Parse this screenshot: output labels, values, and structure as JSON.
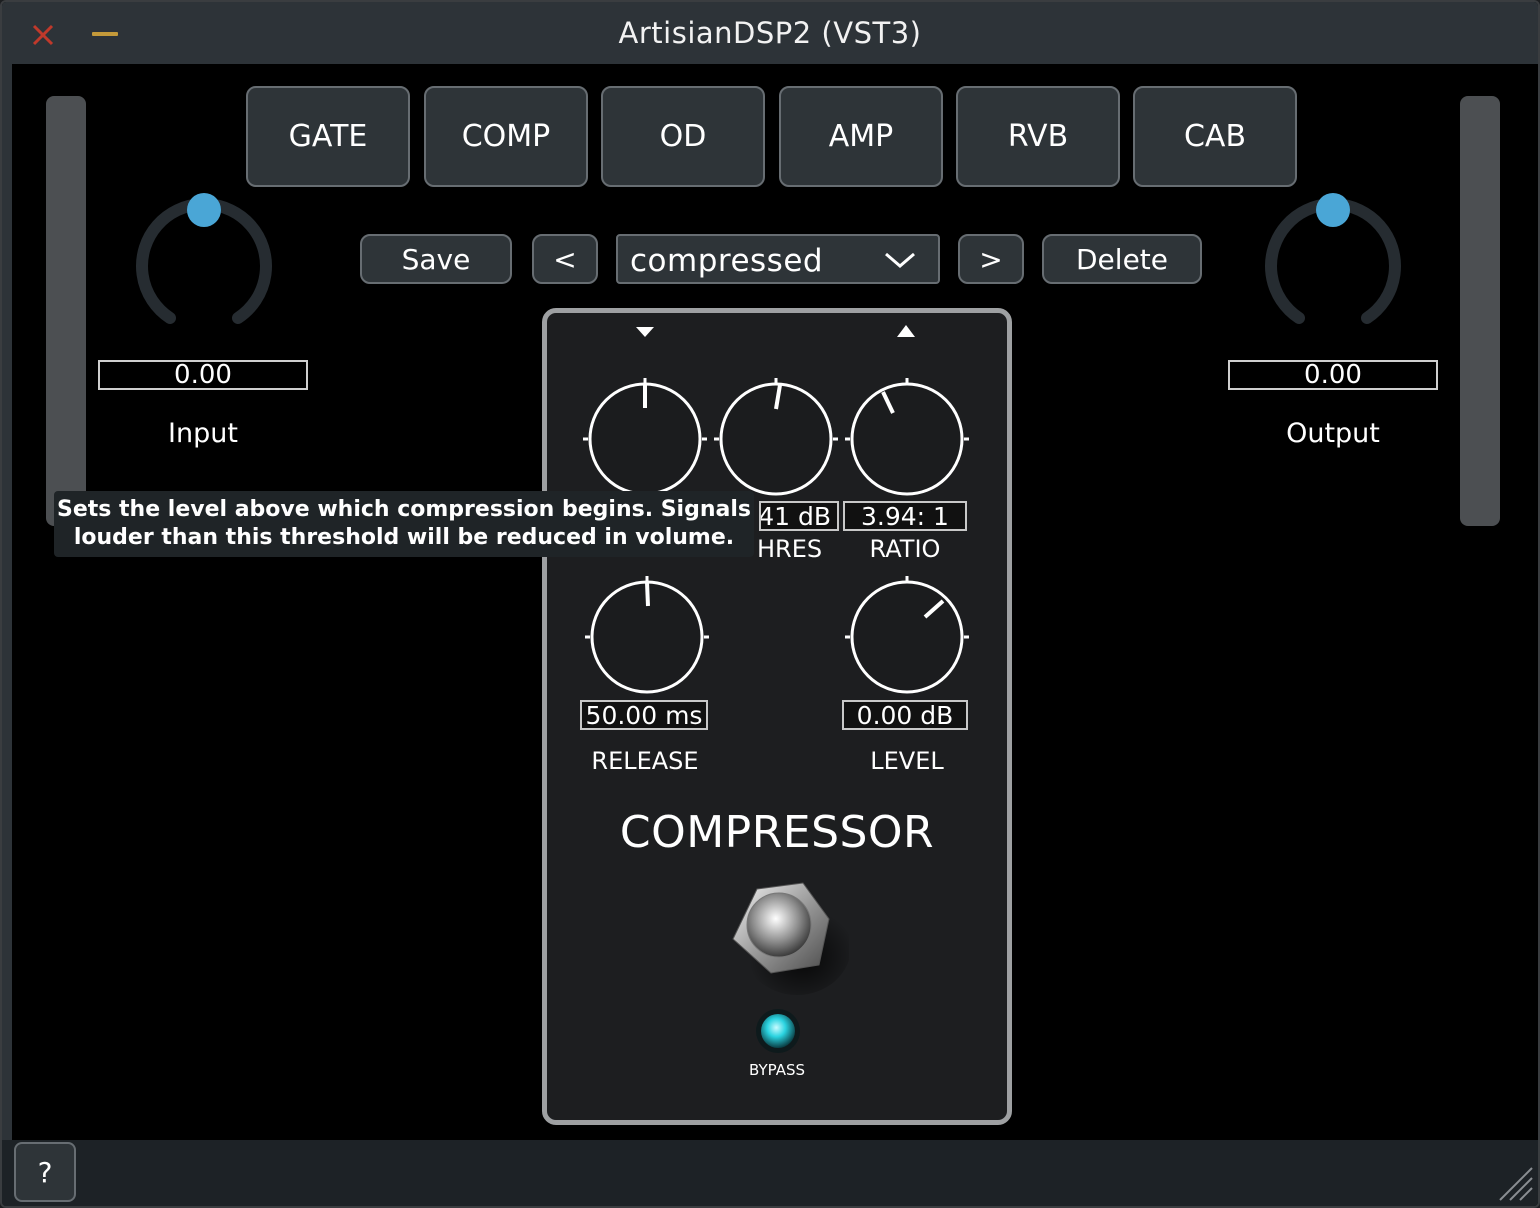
{
  "window": {
    "title": "ArtisianDSP2 (VST3)",
    "close_icon": "close-icon",
    "minimize_icon": "minimize-icon"
  },
  "effects_tabs": [
    "GATE",
    "COMP",
    "OD",
    "AMP",
    "RVB",
    "CAB"
  ],
  "preset_bar": {
    "save_label": "Save",
    "prev_label": "<",
    "preset_name": "compressed",
    "next_label": ">",
    "delete_label": "Delete"
  },
  "input": {
    "label": "Input",
    "value": "0.00"
  },
  "output": {
    "label": "Output",
    "value": "0.00"
  },
  "pedal": {
    "name": "COMPRESSOR",
    "knobs": {
      "threshold": {
        "value": ".41 dB",
        "label": "HRES"
      },
      "ratio": {
        "value": "3.94: 1",
        "label": "RATIO"
      },
      "release": {
        "value": "50.00 ms",
        "label": "RELEASE"
      },
      "level": {
        "value": "0.00 dB",
        "label": "LEVEL"
      }
    },
    "bypass_label": "BYPASS",
    "bypass_led_color": "#2ad3e0"
  },
  "tooltip": {
    "line1": "Sets the level above which compression begins. Signals",
    "line2": "louder than this threshold will be reduced in volume."
  },
  "footer": {
    "help_label": "?"
  },
  "colors": {
    "accent": "#4aa6d6",
    "button_bg": "#2e3438",
    "button_border": "#676d72",
    "title_bar": "#2d3338"
  }
}
